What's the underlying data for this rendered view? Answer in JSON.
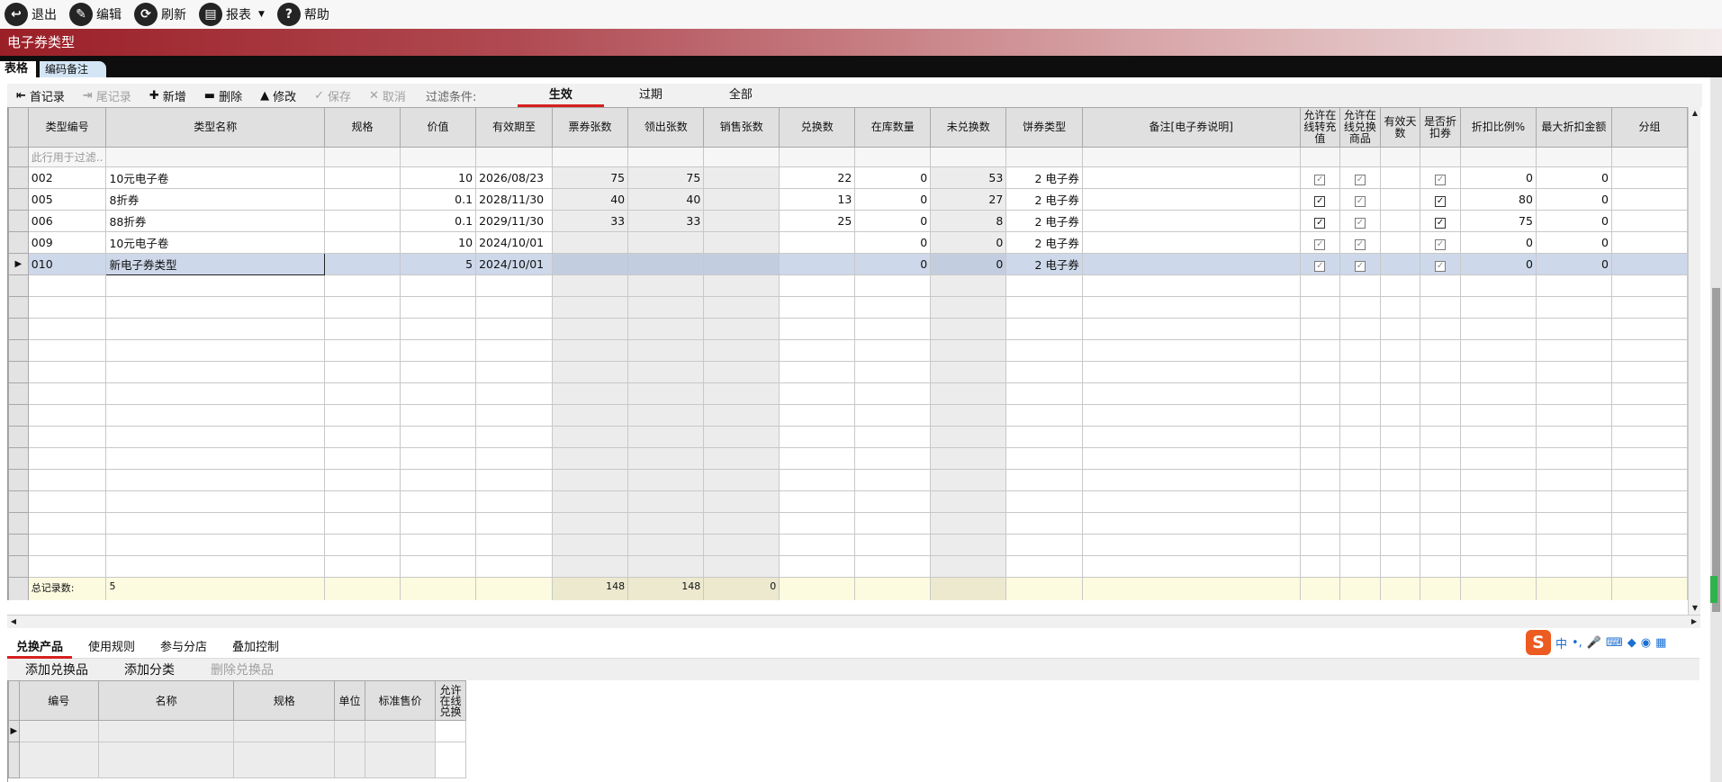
{
  "toolbar": {
    "exit": "退出",
    "edit": "编辑",
    "refresh": "刷新",
    "report": "报表",
    "help": "帮助"
  },
  "window_title": "电子券类型",
  "tabs": {
    "table": "表格",
    "code_note": "编码备注"
  },
  "grid_toolbar": {
    "first": "首记录",
    "last": "尾记录",
    "add": "新增",
    "delete": "删除",
    "modify": "修改",
    "save": "保存",
    "cancel": "取消",
    "filter_label": "过滤条件:",
    "filter_tabs": [
      "生效",
      "过期",
      "全部"
    ]
  },
  "columns": [
    "类型编号",
    "类型名称",
    "规格",
    "价值",
    "有效期至",
    "票券张数",
    "领出张数",
    "销售张数",
    "兑换数",
    "在库数量",
    "未兑换数",
    "饼券类型",
    "备注[电子券说明]",
    "允许在线转充值",
    "允许在线兑换商品",
    "有效天数",
    "是否折扣券",
    "折扣比例%",
    "最大折扣金额",
    "分组"
  ],
  "filter_placeholder": "此行用于过滤..",
  "rows": [
    {
      "code": "002",
      "name": "10元电子卷",
      "spec": "",
      "value": "10",
      "expire": "2026/08/23",
      "tickets": "75",
      "issued": "75",
      "sold": "",
      "redeemed": "22",
      "stock": "0",
      "unredeemed": "53",
      "ptype": "2 电子券",
      "note": "",
      "online_recharge": false,
      "online_exchange": false,
      "days": "",
      "is_discount": false,
      "discount_pct": "0",
      "max_discount": "0",
      "group": ""
    },
    {
      "code": "005",
      "name": "8折券",
      "spec": "",
      "value": "0.1",
      "expire": "2028/11/30",
      "tickets": "40",
      "issued": "40",
      "sold": "",
      "redeemed": "13",
      "stock": "0",
      "unredeemed": "27",
      "ptype": "2 电子券",
      "note": "",
      "online_recharge": true,
      "online_exchange": false,
      "days": "",
      "is_discount": true,
      "discount_pct": "80",
      "max_discount": "0",
      "group": ""
    },
    {
      "code": "006",
      "name": "88折券",
      "spec": "",
      "value": "0.1",
      "expire": "2029/11/30",
      "tickets": "33",
      "issued": "33",
      "sold": "",
      "redeemed": "25",
      "stock": "0",
      "unredeemed": "8",
      "ptype": "2 电子券",
      "note": "",
      "online_recharge": true,
      "online_exchange": false,
      "days": "",
      "is_discount": true,
      "discount_pct": "75",
      "max_discount": "0",
      "group": ""
    },
    {
      "code": "009",
      "name": "10元电子卷",
      "spec": "",
      "value": "10",
      "expire": "2024/10/01",
      "tickets": "",
      "issued": "",
      "sold": "",
      "redeemed": "",
      "stock": "0",
      "unredeemed": "0",
      "ptype": "2 电子券",
      "note": "",
      "online_recharge": false,
      "online_exchange": false,
      "days": "",
      "is_discount": false,
      "discount_pct": "0",
      "max_discount": "0",
      "group": ""
    },
    {
      "code": "010",
      "name": "新电子券类型",
      "spec": "",
      "value": "5",
      "expire": "2024/10/01",
      "tickets": "",
      "issued": "",
      "sold": "",
      "redeemed": "",
      "stock": "0",
      "unredeemed": "0",
      "ptype": "2 电子券",
      "note": "",
      "online_recharge": false,
      "online_exchange": false,
      "days": "",
      "is_discount": false,
      "discount_pct": "0",
      "max_discount": "0",
      "group": ""
    }
  ],
  "totals": {
    "label": "总记录数:",
    "count": "5",
    "tickets": "148",
    "issued": "148",
    "sold": "0"
  },
  "bottom_tabs": [
    "兑换产品",
    "使用规则",
    "参与分店",
    "叠加控制"
  ],
  "bottom_toolbar": {
    "add_product": "添加兑换品",
    "add_category": "添加分类",
    "delete_product": "删除兑换品"
  },
  "bottom_columns": [
    "编号",
    "名称",
    "规格",
    "单位",
    "标准售价",
    "允许在线兑换"
  ],
  "ime": {
    "logo": "S",
    "lang": "中",
    "punct": "•,"
  }
}
